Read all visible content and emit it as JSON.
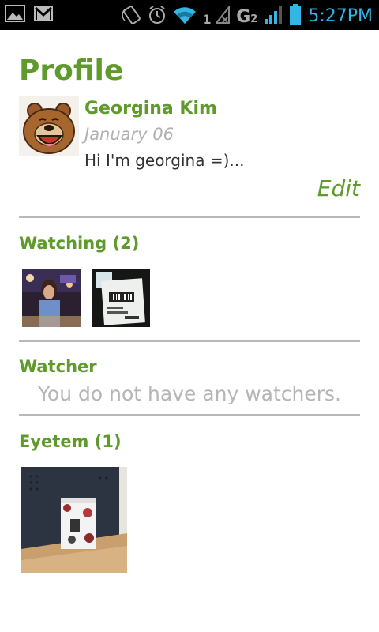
{
  "status_bar": {
    "sim_label": "1",
    "net_label": "G",
    "net_sub": "2",
    "time": "5:27PM"
  },
  "profile": {
    "title": "Profile",
    "name": "Georgina Kim",
    "date": "January 06",
    "bio": "Hi I'm georgina =)...",
    "edit_label": "Edit"
  },
  "watching": {
    "header": "Watching (2)"
  },
  "watcher": {
    "header": "Watcher",
    "empty_message": "You do not have any watchers."
  },
  "eyetem": {
    "header": "Eyetem (1)"
  },
  "colors": {
    "accent_green": "#5f9a2c",
    "divider_gray": "#b9b9b9",
    "status_blue": "#33b5e5"
  }
}
